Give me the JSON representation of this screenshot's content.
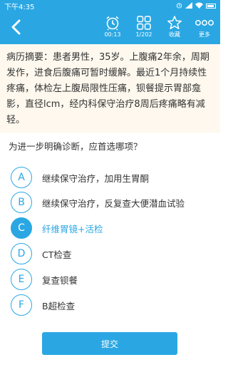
{
  "status_bar": {
    "time": "下午4:35"
  },
  "toolbar": {
    "timer_label": "00:13",
    "progress_label": "1/202",
    "favorite_label": "收藏",
    "more_label": "更多"
  },
  "case": {
    "text": "病历摘要：患者男性，35岁。上腹痛2年余，周期发作，进食后腹痛可暂时缓解。最近1个月持续性疼痛，体检左上腹局限性压痛，钡餐提示胃部龛影，直径lcm，经内科保守治疗8周后疼痛略有减轻。"
  },
  "question": {
    "text": "为进一步明确诊断，应首选哪项？"
  },
  "options": [
    {
      "letter": "A",
      "text": "继续保守治疗，加用生胃酮",
      "selected": false
    },
    {
      "letter": "B",
      "text": "继续保守治疗，反复查大便潜血试验",
      "selected": false
    },
    {
      "letter": "C",
      "text": "纤维胃镜+活检",
      "selected": true
    },
    {
      "letter": "D",
      "text": "CT检查",
      "selected": false
    },
    {
      "letter": "E",
      "text": "复查钡餐",
      "selected": false
    },
    {
      "letter": "F",
      "text": "B超检查",
      "selected": false
    }
  ],
  "submit": {
    "label": "提交"
  },
  "colors": {
    "accent": "#2aa7e3",
    "case_background": "#fef8ee",
    "text": "#333333"
  }
}
